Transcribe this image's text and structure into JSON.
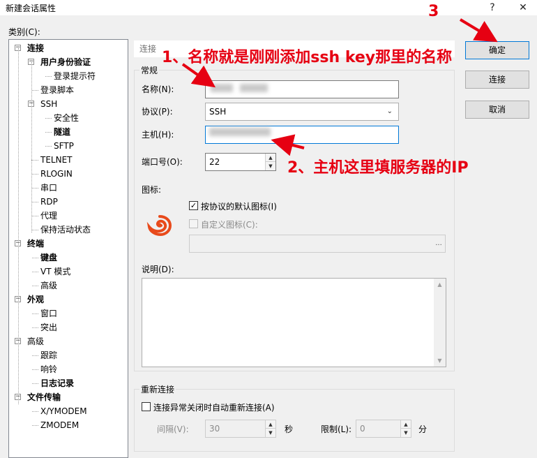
{
  "window": {
    "title": "新建会话属性",
    "help_glyph": "?",
    "close_glyph": "✕"
  },
  "category_label": "类别(C):",
  "tree": [
    {
      "label": "连接",
      "bold": true,
      "toggle": "−"
    },
    {
      "label": "用户身份验证",
      "bold": true,
      "toggle": "−"
    },
    {
      "label": "登录提示符",
      "bold": false
    },
    {
      "label": "登录脚本",
      "bold": false
    },
    {
      "label": "SSH",
      "bold": false,
      "toggle": "−"
    },
    {
      "label": "安全性",
      "bold": false
    },
    {
      "label": "隧道",
      "bold": true
    },
    {
      "label": "SFTP",
      "bold": false
    },
    {
      "label": "TELNET",
      "bold": false
    },
    {
      "label": "RLOGIN",
      "bold": false
    },
    {
      "label": "串口",
      "bold": false
    },
    {
      "label": "RDP",
      "bold": false
    },
    {
      "label": "代理",
      "bold": false
    },
    {
      "label": "保持活动状态",
      "bold": false
    },
    {
      "label": "终端",
      "bold": true,
      "toggle": "−"
    },
    {
      "label": "键盘",
      "bold": true
    },
    {
      "label": "VT 模式",
      "bold": false
    },
    {
      "label": "高级",
      "bold": false
    },
    {
      "label": "外观",
      "bold": true,
      "toggle": "−"
    },
    {
      "label": "窗口",
      "bold": false
    },
    {
      "label": "突出",
      "bold": false
    },
    {
      "label": "高级",
      "bold": false,
      "toggle": "−"
    },
    {
      "label": "跟踪",
      "bold": false
    },
    {
      "label": "响铃",
      "bold": false
    },
    {
      "label": "日志记录",
      "bold": true
    },
    {
      "label": "文件传输",
      "bold": true,
      "toggle": "−"
    },
    {
      "label": "X/YMODEM",
      "bold": false
    },
    {
      "label": "ZMODEM",
      "bold": false
    }
  ],
  "breadcrumb": "连接",
  "general": {
    "group_title": "常规",
    "name_label": "名称(N):",
    "name_value": "",
    "protocol_label": "协议(P):",
    "protocol_value": "SSH",
    "host_label": "主机(H):",
    "host_value": "",
    "port_label": "端口号(O):",
    "port_value": "22",
    "icon_label": "图标:",
    "default_icon_checkbox": "按协议的默认图标(I)",
    "custom_icon_checkbox": "自定义图标(C):",
    "browse_button": "...",
    "description_label": "说明(D):"
  },
  "reconnect": {
    "group_title": "重新连接",
    "auto_reconnect_checkbox": "连接异常关闭时自动重新连接(A)",
    "interval_label": "间隔(V):",
    "interval_value": "30",
    "interval_unit": "秒",
    "limit_label": "限制(L):",
    "limit_value": "0",
    "limit_unit": "分"
  },
  "buttons": {
    "ok": "确定",
    "connect": "连接",
    "cancel": "取消"
  },
  "annotations": {
    "step1": "1、名称就是刚刚添加ssh key那里的名称",
    "step2": "2、主机这里填服务器的IP",
    "step3": "3"
  },
  "colors": {
    "annotation": "#e60012",
    "focus_border": "#0078d7"
  }
}
